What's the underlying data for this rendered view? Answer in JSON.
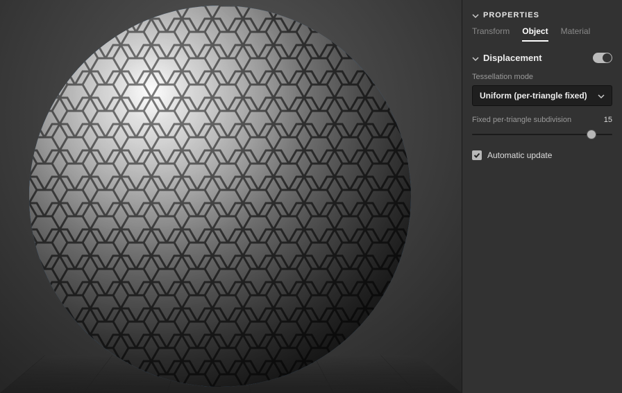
{
  "panel": {
    "title": "PROPERTIES",
    "tabs": [
      {
        "label": "Transform",
        "active": false
      },
      {
        "label": "Object",
        "active": true
      },
      {
        "label": "Material",
        "active": false
      }
    ],
    "section": {
      "label": "Displacement",
      "enabled": true,
      "tess_label": "Tessellation mode",
      "tess_value": "Uniform (per-triangle fixed)",
      "subdiv_label": "Fixed per-triangle subdivision",
      "subdiv_value": "15",
      "auto_label": "Automatic update",
      "auto_checked": true
    }
  },
  "colors": {
    "selection": "#1a8cff"
  }
}
